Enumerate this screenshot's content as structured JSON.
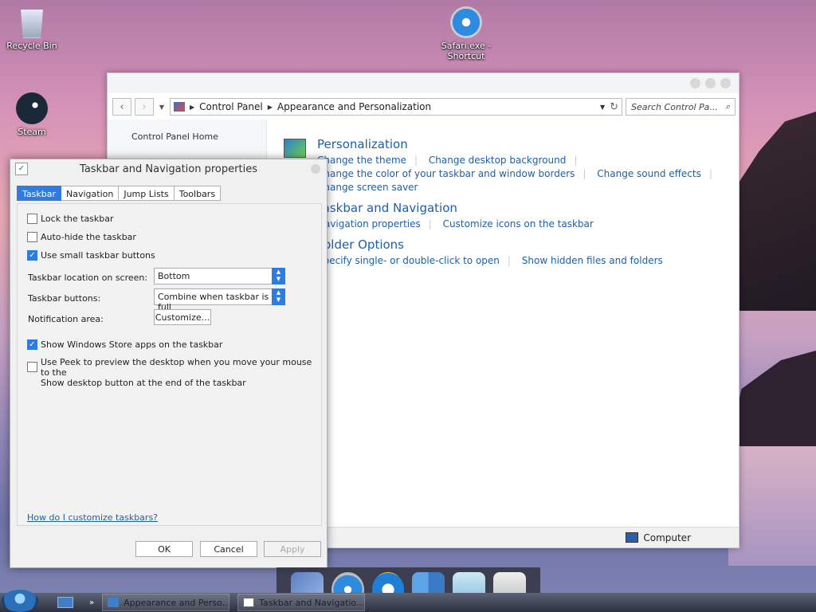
{
  "desktop": {
    "icons": [
      {
        "label": "Recycle Bin"
      },
      {
        "label": "Steam"
      },
      {
        "label": "Safari.exe - Shortcut"
      }
    ]
  },
  "control_panel": {
    "breadcrumb": [
      "Control Panel",
      "Appearance and Personalization"
    ],
    "search_placeholder": "Search Control Pa...",
    "left_nav": {
      "home": "Control Panel Home"
    },
    "sections": [
      {
        "heading": "Personalization",
        "links": [
          "Change the theme",
          "Change desktop background",
          "Change the color of your taskbar and window borders",
          "Change sound effects",
          "Change screen saver"
        ]
      },
      {
        "heading": "Taskbar and Navigation",
        "links": [
          "Navigation properties",
          "Customize icons on the taskbar"
        ]
      },
      {
        "heading": "Folder Options",
        "links": [
          "Specify single- or double-click to open",
          "Show hidden files and folders"
        ]
      }
    ],
    "status": "Computer"
  },
  "dialog": {
    "title": "Taskbar and Navigation properties",
    "tabs": [
      "Taskbar",
      "Navigation",
      "Jump Lists",
      "Toolbars"
    ],
    "active_tab": "Taskbar",
    "checkboxes": [
      {
        "label": "Lock the taskbar",
        "checked": false
      },
      {
        "label": "Auto-hide the taskbar",
        "checked": false
      },
      {
        "label": "Use small taskbar buttons",
        "checked": true
      }
    ],
    "location_label": "Taskbar location on screen:",
    "location_value": "Bottom",
    "buttons_label": "Taskbar buttons:",
    "buttons_value": "Combine when taskbar is full",
    "notification_label": "Notification area:",
    "customize_label": "Customize...",
    "store_apps": {
      "label": "Show Windows Store apps on the taskbar",
      "checked": true
    },
    "peek": {
      "label_line1": "Use Peek to preview the desktop when you move your mouse to the",
      "label_line2": "Show desktop button at the end of the taskbar",
      "checked": false
    },
    "help_link": "How do I customize taskbars?",
    "ok": "OK",
    "cancel": "Cancel",
    "apply": "Apply"
  },
  "taskbar": {
    "items": [
      "Appearance and Perso...",
      "Taskbar and Navigatio..."
    ]
  }
}
